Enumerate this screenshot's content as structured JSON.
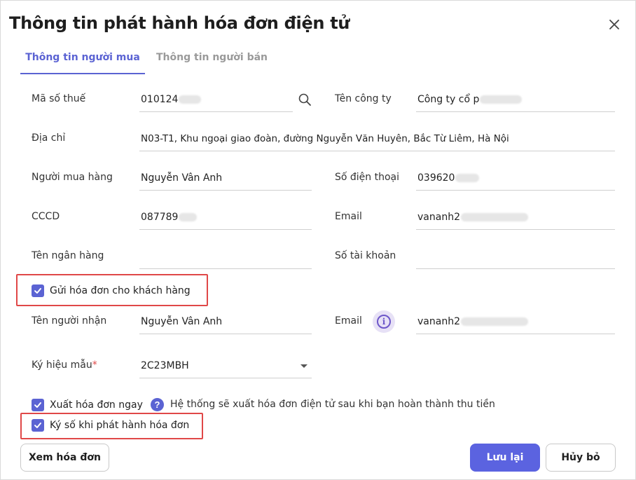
{
  "dialog": {
    "title": "Thông tin phát hành hóa đơn điện tử"
  },
  "tabs": [
    {
      "label": "Thông tin người mua",
      "active": true
    },
    {
      "label": "Thông tin người bán",
      "active": false
    }
  ],
  "form": {
    "tax_code": {
      "label": "Mã số thuế",
      "value": "010124"
    },
    "company": {
      "label": "Tên công ty",
      "value": "Công ty cổ p"
    },
    "address": {
      "label": "Địa chỉ",
      "value": "N03-T1, Khu ngoại giao đoàn, đường Nguyễn Văn Huyên, Bắc Từ Liêm, Hà Nội"
    },
    "buyer": {
      "label": "Người mua hàng",
      "value": "Nguyễn Vân Anh"
    },
    "phone": {
      "label": "Số điện thoại",
      "value": "039620"
    },
    "id_card": {
      "label": "CCCD",
      "value": "087789"
    },
    "email": {
      "label": "Email",
      "value": "vananh2"
    },
    "bank_name": {
      "label": "Tên ngân hàng",
      "value": ""
    },
    "account_no": {
      "label": "Số tài khoản",
      "value": ""
    },
    "send_invoice": {
      "label": "Gửi hóa đơn cho khách hàng",
      "checked": true
    },
    "recipient": {
      "label": "Tên người nhận",
      "value": "Nguyễn Vân Anh"
    },
    "recipient_email": {
      "label": "Email",
      "value": "vananh2"
    },
    "template_symbol": {
      "label": "Ký hiệu mẫu",
      "required_mark": "*",
      "value": "2C23MBH"
    },
    "issue_now": {
      "label": "Xuất hóa đơn ngay",
      "checked": true
    },
    "issue_hint": "Hệ thống sẽ xuất hóa đơn điện tử sau khi bạn hoàn thành thu tiền",
    "sign_on_issue": {
      "label": "Ký số khi phát hành hóa đơn",
      "checked": true
    }
  },
  "buttons": {
    "preview": "Xem hóa đơn",
    "save": "Lưu lại",
    "cancel": "Hủy bỏ"
  },
  "colors": {
    "accent": "#5b63d3",
    "primary_button": "#5b63e0",
    "highlight_box": "#e04848",
    "info_bg": "#e7e1f6"
  }
}
